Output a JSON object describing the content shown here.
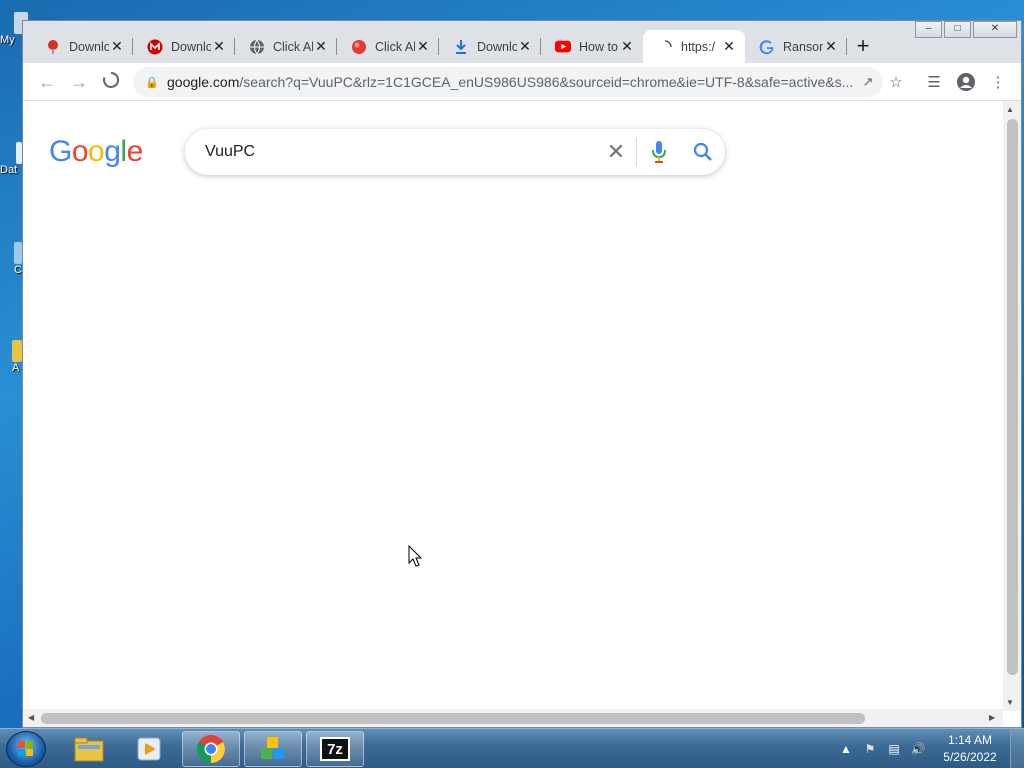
{
  "desktop": {
    "icons": [
      {
        "label": "My"
      },
      {
        "label": "Dat"
      },
      {
        "label": "C"
      },
      {
        "label": "A"
      }
    ]
  },
  "browser": {
    "tabs": [
      {
        "title": "Download",
        "icon": "pin-icon",
        "color": "#d93025"
      },
      {
        "title": "Download",
        "icon": "m-logo-icon",
        "color": "#d50000"
      },
      {
        "title": "Click Al",
        "icon": "globe-icon",
        "color": "#5f6368"
      },
      {
        "title": "Click Al",
        "icon": "red-circle-icon",
        "color": "#e53935"
      },
      {
        "title": "Download",
        "icon": "download-icon",
        "color": "#1a73e8"
      },
      {
        "title": "How to",
        "icon": "youtube-icon",
        "color": "#ff0000"
      },
      {
        "title": "https:/",
        "icon": "loading-icon",
        "color": "#5f6368",
        "active": true
      },
      {
        "title": "Ransom",
        "icon": "google-g-icon",
        "color": "#4285f4"
      }
    ],
    "address": {
      "host": "google.com",
      "path": "/search?q=VuuPC&rlz=1C1GCEA_enUS986US986&sourceid=chrome&ie=UTF-8&safe=active&s..."
    }
  },
  "page": {
    "logo_text": "Google",
    "search_query": "VuuPC"
  },
  "taskbar": {
    "apps": [
      "explorer-icon",
      "media-player-icon",
      "chrome-icon",
      "package-icon",
      "7zip-icon"
    ],
    "zip_label": "7z",
    "time": "1:14 AM",
    "date": "5/26/2022"
  }
}
